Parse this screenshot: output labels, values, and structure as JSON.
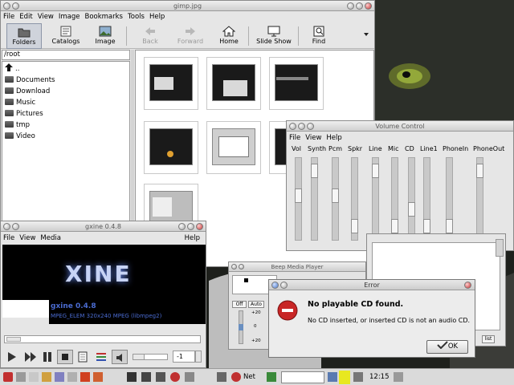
{
  "colors": {
    "accent": "#b22222",
    "dialog_title_bg": "#dadada",
    "xine_text": "#4a6bd0"
  },
  "gimpview": {
    "title": "gimp.jpg",
    "menu": [
      "File",
      "Edit",
      "View",
      "Image",
      "Bookmarks",
      "Tools",
      "Help"
    ],
    "toolbar": [
      {
        "label": "Folders",
        "icon": "folder-icon",
        "active": true
      },
      {
        "label": "Catalogs",
        "icon": "catalog-icon"
      },
      {
        "label": "Image",
        "icon": "image-icon"
      },
      {
        "label": "Back",
        "icon": "back-arrow-icon",
        "disabled": true
      },
      {
        "label": "Forward",
        "icon": "forward-arrow-icon",
        "disabled": true
      },
      {
        "label": "Home",
        "icon": "home-icon"
      },
      {
        "label": "Slide Show",
        "icon": "slideshow-icon"
      },
      {
        "label": "Find",
        "icon": "find-icon"
      }
    ],
    "path": "/root",
    "tree": [
      "..",
      "Documents",
      "Download",
      "Music",
      "Pictures",
      "tmp",
      "Video"
    ]
  },
  "volume": {
    "title": "Volume Control",
    "menu": [
      "File",
      "View",
      "Help"
    ],
    "channels": [
      {
        "name": "Vol",
        "level": 0.55
      },
      {
        "name": "Synth",
        "level": 0.92
      },
      {
        "name": "Pcm",
        "level": 0.55
      },
      {
        "name": "Spkr",
        "level": 0.1
      },
      {
        "name": "Line",
        "level": 0.92
      },
      {
        "name": "Mic",
        "level": 0.1
      },
      {
        "name": "CD",
        "level": 0.35
      },
      {
        "name": "Line1",
        "level": 0.1
      },
      {
        "name": "PhoneIn",
        "level": 0.1
      },
      {
        "name": "PhoneOut",
        "level": 0.92
      }
    ]
  },
  "gxine": {
    "title": "gxine 0.4.8",
    "menu_left": [
      "File",
      "View",
      "Media"
    ],
    "menu_right": "Help",
    "logo": "XINE",
    "info_title": "gxine 0.4.8",
    "info_sub": "MPEG_ELEM 320x240 MPEG (libmpeg2)",
    "spin": "-1"
  },
  "bmp": {
    "title": "Beep Media Player",
    "off": "Off",
    "auto": "Auto",
    "db_top": "+20",
    "db_mid": "0",
    "db_bot": "+20",
    "list": "list"
  },
  "error": {
    "title": "Error",
    "heading": "No playable CD found.",
    "message": "No CD inserted, or inserted CD is not an audio CD.",
    "ok": "OK"
  },
  "taskbar": {
    "net": "Net",
    "clock": "12:15"
  }
}
